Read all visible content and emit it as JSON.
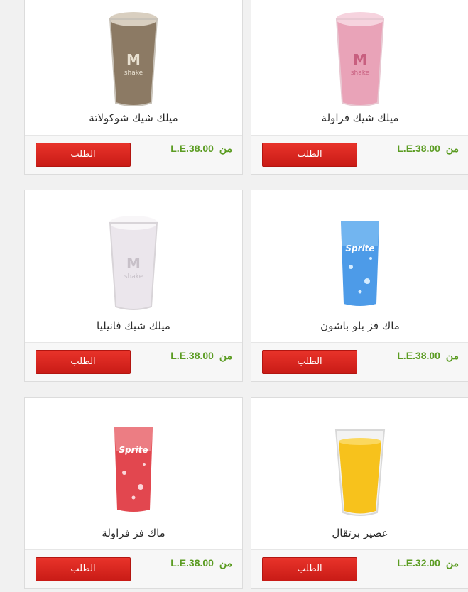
{
  "products": [
    {
      "name": "ميلك شيك شوكولاتة",
      "price_prefix": "من",
      "price": "L.E.38.00",
      "order_label": "الطلب",
      "icon": "chocolate-shake-icon",
      "logo": "M",
      "logo_sub": "shake"
    },
    {
      "name": "ميلك شيك فراولة",
      "price_prefix": "من",
      "price": "L.E.38.00",
      "order_label": "الطلب",
      "icon": "strawberry-shake-icon",
      "logo": "M",
      "logo_sub": "shake"
    },
    {
      "name": "ميلك شيك فانيليا",
      "price_prefix": "من",
      "price": "L.E.38.00",
      "order_label": "الطلب",
      "icon": "vanilla-shake-icon",
      "logo": "M",
      "logo_sub": "shake"
    },
    {
      "name": "ماك فز بلو باشون",
      "price_prefix": "من",
      "price": "L.E.38.00",
      "order_label": "الطلب",
      "icon": "blue-fizz-icon",
      "logo": "Sprite"
    },
    {
      "name": "ماك فز فراولة",
      "price_prefix": "من",
      "price": "L.E.38.00",
      "order_label": "الطلب",
      "icon": "strawberry-fizz-icon",
      "logo": "Sprite"
    },
    {
      "name": "عصير برتقال",
      "price_prefix": "من",
      "price": "L.E.32.00",
      "order_label": "الطلب",
      "icon": "orange-juice-icon"
    }
  ],
  "colors": {
    "accent_button": "#d9261f",
    "price_text": "#5b9c22",
    "chocolate": "#8c7a64",
    "strawberry": "#e9a3b8",
    "vanilla": "#ebe6ec",
    "blue_fizz": "#4d9be8",
    "red_fizz": "#e2474f",
    "orange": "#f7c21c"
  }
}
